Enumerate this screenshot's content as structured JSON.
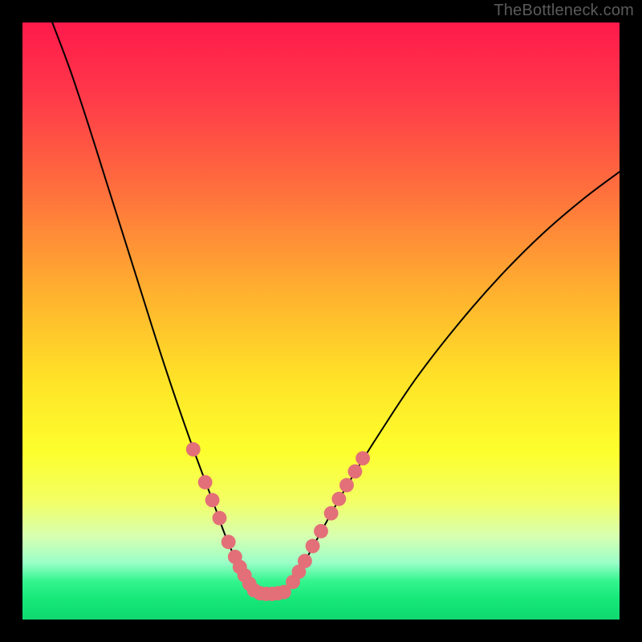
{
  "watermark": "TheBottleneck.com",
  "chart_data": {
    "type": "line",
    "title": "",
    "xlabel": "",
    "ylabel": "",
    "xlim": [
      0,
      100
    ],
    "ylim": [
      0,
      100
    ],
    "grid": false,
    "legend": false,
    "annotations": [],
    "background": {
      "kind": "vertical-gradient",
      "stops": [
        {
          "pos": 0.0,
          "color": "#ff1a4b"
        },
        {
          "pos": 0.12,
          "color": "#ff384a"
        },
        {
          "pos": 0.28,
          "color": "#ff6f3d"
        },
        {
          "pos": 0.45,
          "color": "#ffb02f"
        },
        {
          "pos": 0.6,
          "color": "#ffe327"
        },
        {
          "pos": 0.72,
          "color": "#fdff2d"
        },
        {
          "pos": 0.8,
          "color": "#f3ff63"
        },
        {
          "pos": 0.86,
          "color": "#d8ffb0"
        },
        {
          "pos": 0.905,
          "color": "#9bffc8"
        },
        {
          "pos": 0.935,
          "color": "#35f58f"
        },
        {
          "pos": 0.965,
          "color": "#16e878"
        },
        {
          "pos": 1.0,
          "color": "#0fd870"
        }
      ]
    },
    "series": [
      {
        "name": "curve-left",
        "stroke": "#000000",
        "stroke_width": 2,
        "x": [
          5.0,
          8.0,
          11.0,
          14.0,
          17.0,
          20.0,
          23.0,
          26.0,
          29.0,
          32.0,
          34.0,
          36.0,
          37.5,
          38.8
        ],
        "y": [
          100.0,
          92.0,
          83.0,
          73.5,
          64.0,
          54.5,
          45.0,
          36.0,
          27.5,
          19.5,
          14.0,
          9.5,
          6.7,
          4.8
        ]
      },
      {
        "name": "curve-right",
        "stroke": "#000000",
        "stroke_width": 2,
        "x": [
          44.3,
          46.0,
          48.0,
          51.0,
          55.0,
          60.0,
          66.0,
          73.0,
          80.0,
          87.0,
          94.0,
          100.0
        ],
        "y": [
          4.8,
          7.5,
          11.0,
          16.5,
          23.5,
          31.5,
          40.5,
          49.5,
          57.5,
          64.5,
          70.5,
          75.0
        ]
      },
      {
        "name": "trough-flat",
        "stroke": "#000000",
        "stroke_width": 2,
        "x": [
          38.8,
          40.0,
          41.5,
          43.0,
          44.3
        ],
        "y": [
          4.8,
          4.4,
          4.3,
          4.4,
          4.8
        ]
      },
      {
        "name": "dots-left-branch",
        "kind": "scatter",
        "marker_color": "#e36f78",
        "marker_radius_frac": 0.012,
        "x": [
          28.6,
          30.6,
          31.8,
          33.0,
          34.5,
          35.6,
          36.4,
          37.2,
          38.0,
          38.8
        ],
        "y": [
          28.5,
          23.0,
          20.0,
          17.0,
          13.0,
          10.5,
          8.8,
          7.4,
          6.0,
          4.9
        ]
      },
      {
        "name": "dots-trough",
        "kind": "scatter",
        "marker_color": "#e36f78",
        "marker_radius_frac": 0.012,
        "x": [
          39.8,
          40.8,
          41.8,
          42.8,
          43.8
        ],
        "y": [
          4.4,
          4.3,
          4.3,
          4.4,
          4.6
        ]
      },
      {
        "name": "dots-right-branch",
        "kind": "scatter",
        "marker_color": "#e36f78",
        "marker_radius_frac": 0.012,
        "x": [
          45.3,
          46.3,
          47.3,
          48.6,
          50.0,
          51.7,
          53.0,
          54.3,
          55.7,
          57.0
        ],
        "y": [
          6.3,
          8.0,
          9.8,
          12.3,
          14.8,
          17.8,
          20.2,
          22.5,
          24.8,
          27.0
        ]
      }
    ]
  }
}
